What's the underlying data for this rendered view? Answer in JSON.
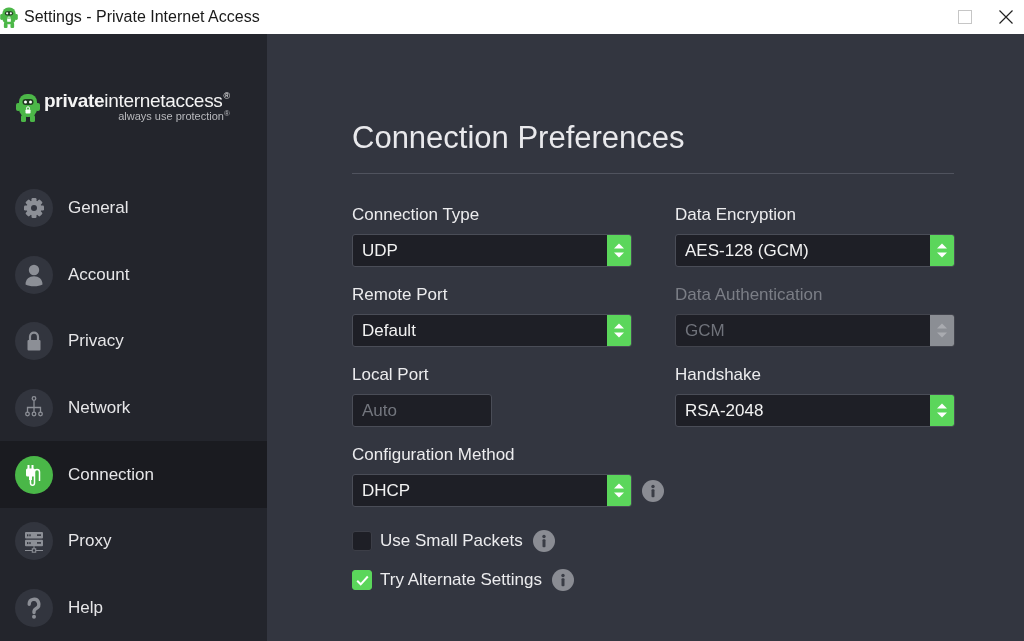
{
  "window": {
    "title": "Settings - Private Internet Access",
    "controls": [
      {
        "kind": "maximize",
        "disabled": true
      },
      {
        "kind": "close",
        "disabled": false
      }
    ]
  },
  "sidebar": {
    "logo": {
      "name": "**private**internetaccess$^{®}$",
      "tagline": "always use protection$^{®}$"
    },
    "items": [
      {
        "label": "General",
        "selected": false
      },
      {
        "label": "Account",
        "selected": false
      },
      {
        "label": "Privacy",
        "selected": false
      },
      {
        "label": "Network",
        "selected": false
      },
      {
        "label": "Connection",
        "selected": true
      },
      {
        "label": "Proxy",
        "selected": false
      },
      {
        "label": "Help",
        "selected": false
      }
    ]
  },
  "page": {
    "heading": "Connection Preferences",
    "columns": [
      {
        "fields": [
          {
            "kind": "select",
            "label": "Connection Type",
            "value": "UDP",
            "disabled": false,
            "info": false
          },
          {
            "kind": "select",
            "label": "Remote Port",
            "value": "Default",
            "disabled": false,
            "info": false
          },
          {
            "kind": "input",
            "label": "Local Port",
            "placeholder": "Auto",
            "disabled": false,
            "info": false
          },
          {
            "kind": "select",
            "label": "Configuration Method",
            "value": "DHCP",
            "disabled": false,
            "info": true
          }
        ]
      },
      {
        "fields": [
          {
            "kind": "select",
            "label": "Data Encryption",
            "value": "AES-128 (GCM)",
            "disabled": false,
            "info": false
          },
          {
            "kind": "select",
            "label": "Data Authentication",
            "value": "GCM",
            "disabled": true,
            "info": false
          },
          {
            "kind": "select",
            "label": "Handshake",
            "value": "RSA-2048",
            "disabled": false,
            "info": false
          }
        ]
      }
    ],
    "options": [
      {
        "label": "Use Small Packets",
        "checked": false,
        "info": true
      },
      {
        "label": "Try Alternate Settings",
        "checked": true,
        "info": true
      }
    ]
  }
}
